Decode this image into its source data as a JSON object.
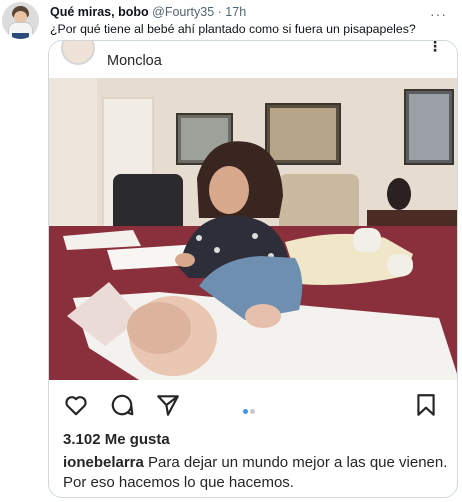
{
  "tweet": {
    "display_name": "Qué miras, bobo",
    "handle": "@Fourty35",
    "separator": "·",
    "time": "17h",
    "more": "···",
    "text": "¿Por qué tiene al bebé ahí plantado como si fuera un pisapapeles?"
  },
  "instagram": {
    "location": "Moncloa",
    "kebab": "⋮",
    "likes": "3.102 Me gusta",
    "caption_user": "ionebelarra",
    "caption_text": "Para dejar un mundo mejor a las que vienen. Por eso hacemos lo que hacemos.",
    "carousel_active_index": 1,
    "carousel_total": 2
  },
  "colors": {
    "accent_blue": "#3897f0",
    "secondary_text": "#536471",
    "border": "#cfd9de",
    "tablecloth": "#8a2f3c"
  }
}
